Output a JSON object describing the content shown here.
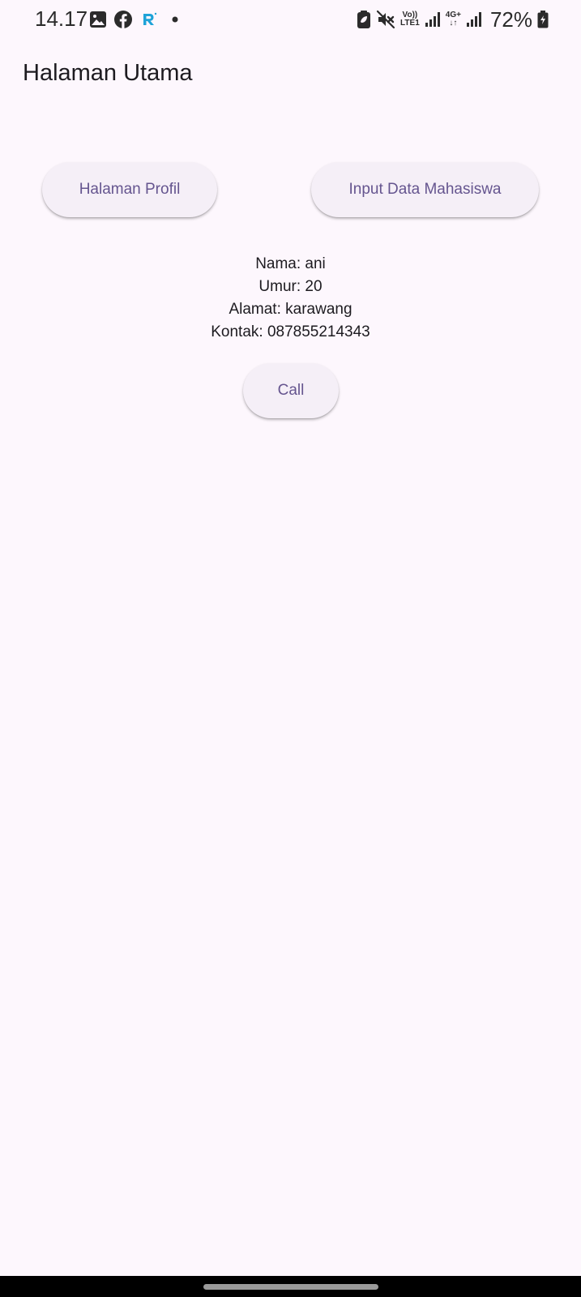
{
  "status_bar": {
    "time": "14.17",
    "left_icons": [
      "gallery-icon",
      "facebook-icon",
      "app-r-icon",
      "notification-dot-icon"
    ],
    "right_icons": [
      "battery-saver-icon",
      "mute-icon",
      "volte-signal-icon",
      "4g-signal-icon",
      "battery-icon"
    ],
    "volte_label_top": "Vo))",
    "volte_label_bottom": "LTE1",
    "network_label": "4G+",
    "battery_percent": "72%"
  },
  "app_bar": {
    "title": "Halaman Utama"
  },
  "buttons": {
    "profile_label": "Halaman Profil",
    "input_label": "Input Data Mahasiswa",
    "call_label": "Call"
  },
  "info": {
    "nama": "Nama: ani",
    "umur": "Umur: 20",
    "alamat": "Alamat: karawang",
    "kontak": "Kontak: 087855214343"
  },
  "colors": {
    "background": "#fdf7fd",
    "button_background": "#f5eff7",
    "button_text": "#65558f",
    "text": "#1d1b20",
    "app_icon_blue": "#1fa3d8"
  }
}
